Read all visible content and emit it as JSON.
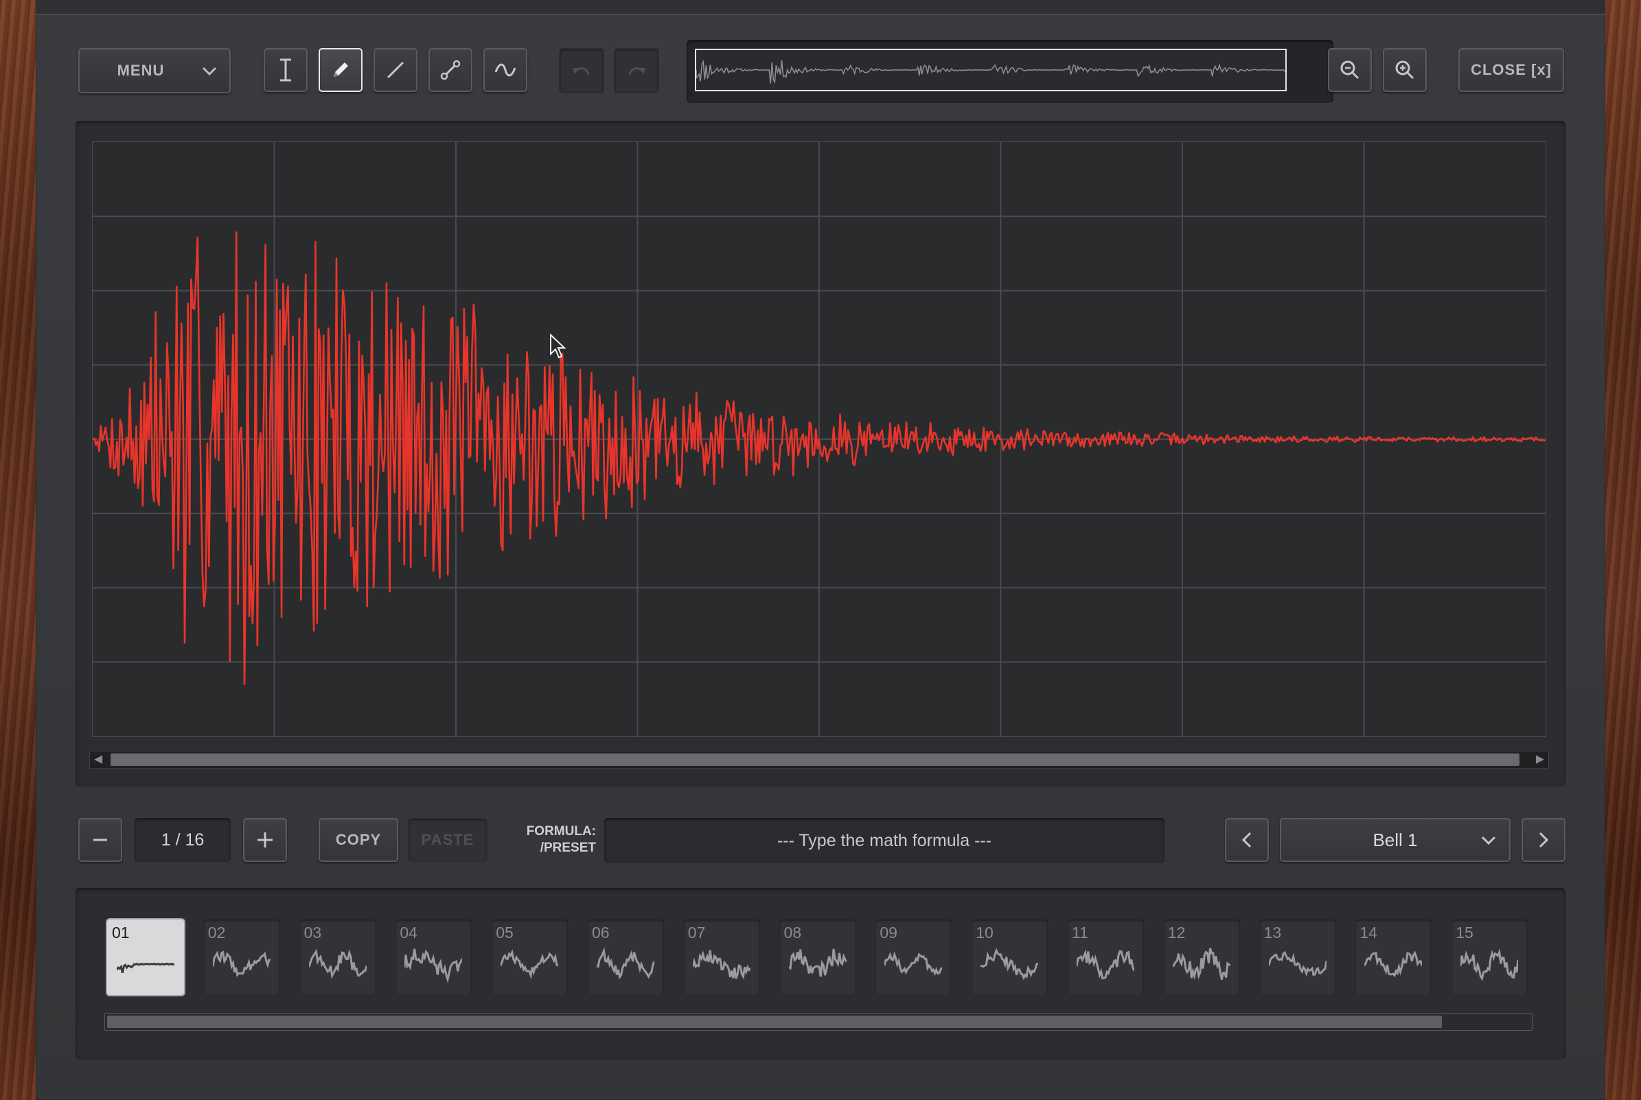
{
  "toolbar": {
    "menu_label": "MENU",
    "close_label": "CLOSE [x]",
    "tools": [
      "text-cursor-icon",
      "pencil-icon",
      "line-icon",
      "node-curve-icon",
      "sine-icon"
    ],
    "active_tool": "pencil-icon",
    "undo_enabled": false,
    "redo_enabled": false
  },
  "controls": {
    "frame_counter": "1 / 16",
    "copy_label": "COPY",
    "paste_label": "PASTE",
    "paste_enabled": false,
    "formula_label_line1": "FORMULA:",
    "formula_label_line2": "/PRESET",
    "formula_placeholder": "--- Type the math formula ---",
    "preset_value": "Bell 1"
  },
  "wavetable": {
    "selected_index": 0,
    "slots": [
      "01",
      "02",
      "03",
      "04",
      "05",
      "06",
      "07",
      "08",
      "09",
      "10",
      "11",
      "12",
      "13",
      "14",
      "15"
    ],
    "scroll_visible_fraction": 0.93
  },
  "colors": {
    "waveform": "#e8352b",
    "panel": "#36373a",
    "grid": "#4a4b4f",
    "selected_slot": "#d8d9db"
  }
}
